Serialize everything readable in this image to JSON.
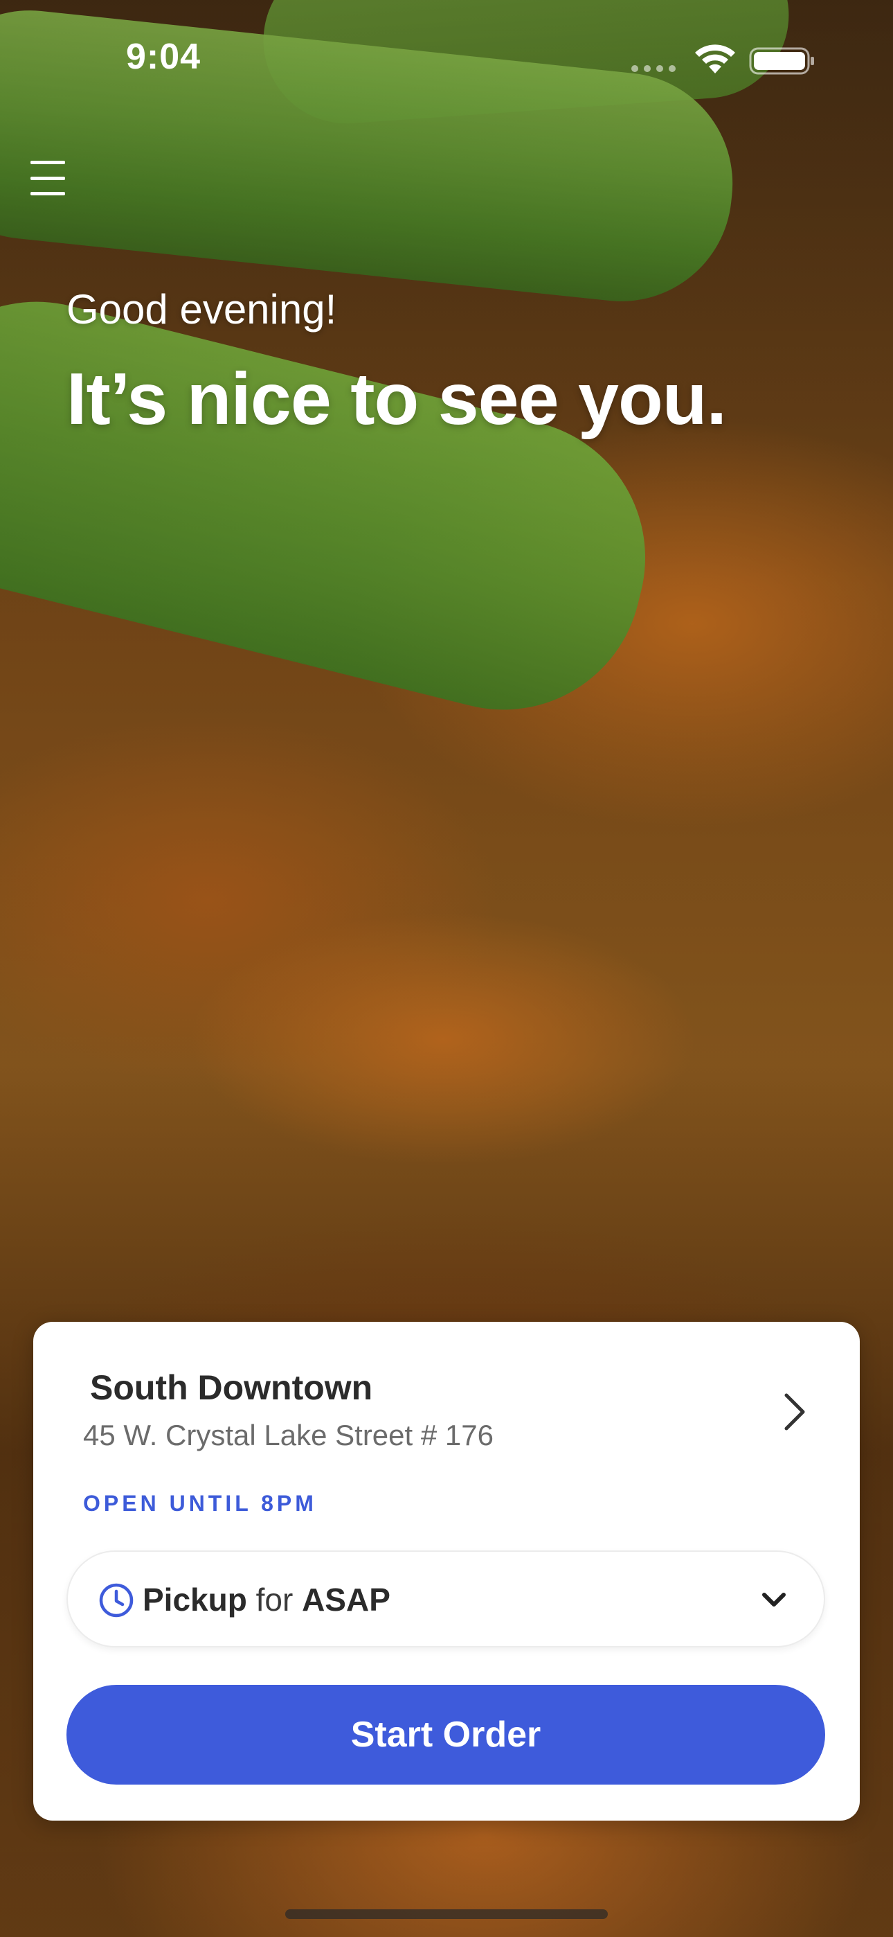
{
  "status_bar": {
    "time": "9:04",
    "wifi_icon": "wifi-icon",
    "battery_icon": "battery-icon"
  },
  "header": {
    "menu_icon": "hamburger-menu-icon"
  },
  "greeting": {
    "subtitle": "Good evening!",
    "title": "It’s nice to see you."
  },
  "location": {
    "name": "South Downtown",
    "address": "45 W. Crystal Lake Street # 176",
    "hours": "OPEN UNTIL 8PM",
    "chevron_icon": "chevron-right-icon"
  },
  "order_mode": {
    "icon": "clock-icon",
    "mode": "Pickup",
    "connector": "for",
    "time": "ASAP",
    "dropdown_icon": "chevron-down-icon"
  },
  "actions": {
    "start_order": "Start Order"
  },
  "colors": {
    "accent": "#3e5bdb",
    "hours_text": "#3d5bd9",
    "card_bg": "#ffffff"
  }
}
